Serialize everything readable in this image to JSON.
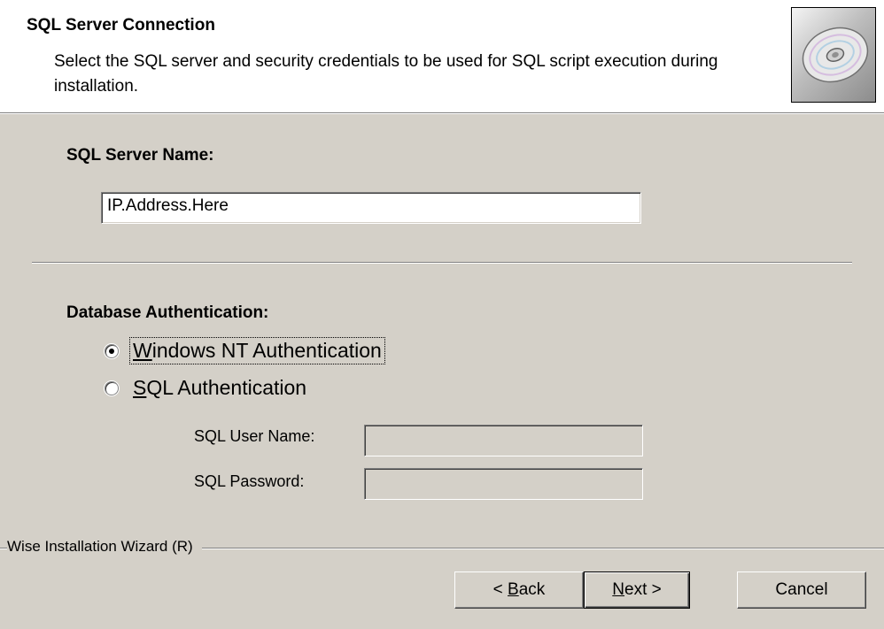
{
  "header": {
    "title": "SQL Server Connection",
    "description": "Select the SQL server and security credentials to be used for SQL script execution during installation.",
    "logo_icon": "cd-disc-icon"
  },
  "server": {
    "label": "SQL Server Name:",
    "value": "IP.Address.Here"
  },
  "auth": {
    "label": "Database Authentication:",
    "options": [
      {
        "label_accel": "W",
        "label_rest": "indows NT Authentication",
        "checked": true
      },
      {
        "label_accel": "S",
        "label_rest": "QL Authentication",
        "checked": false
      }
    ],
    "user_label": "SQL User Name:",
    "user_value": "",
    "password_label": "SQL Password:",
    "password_value": ""
  },
  "footer": {
    "wizard_label": "Wise Installation Wizard (R)",
    "back_prefix": "< ",
    "back_accel": "B",
    "back_rest": "ack",
    "next_accel": "N",
    "next_rest": "ext >",
    "cancel_label": "Cancel"
  },
  "colors": {
    "dialog_bg": "#d4d0c8",
    "header_bg": "#ffffff"
  }
}
